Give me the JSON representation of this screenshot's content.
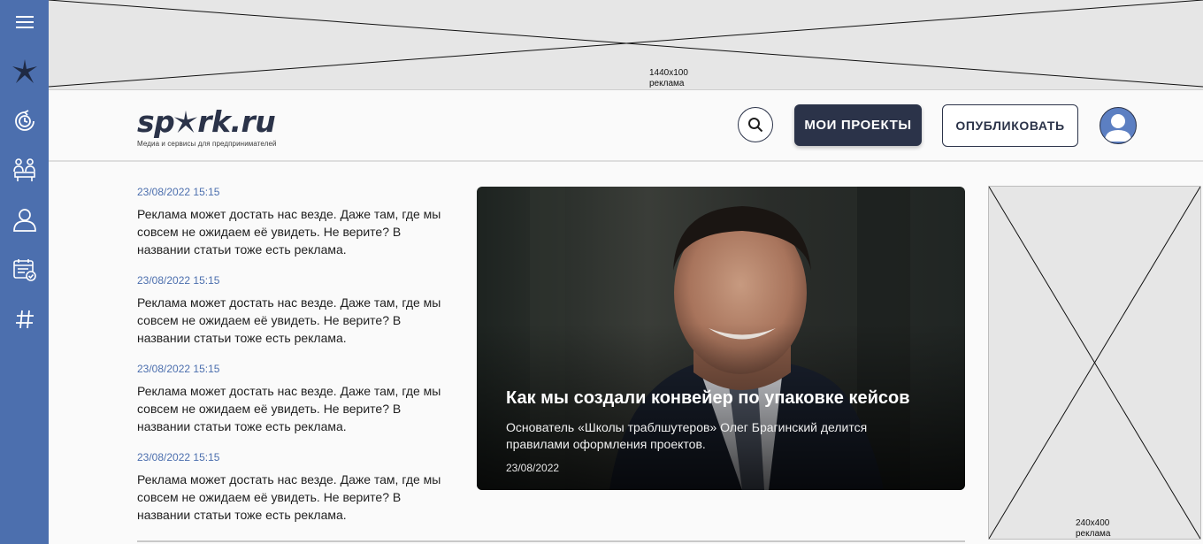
{
  "sidebar": {
    "icons": [
      "menu-icon",
      "star-icon",
      "clock-refresh-icon",
      "meeting-icon",
      "user-icon",
      "calendar-check-icon",
      "hashtag-icon"
    ],
    "color": "#4c6fae"
  },
  "ads": {
    "top": {
      "size": "1440x100",
      "label": "реклама"
    },
    "side": {
      "size": "240x400",
      "label": "реклама"
    }
  },
  "header": {
    "logo_prefix": "sp",
    "logo_suffix": "rk.ru",
    "logo_tagline": "Медиа и сервисы для предпринимателей",
    "my_projects_label": "МОИ ПРОЕКТЫ",
    "publish_label": "ОПУБЛИКОВАТЬ",
    "brand_color": "#2b3349"
  },
  "news": [
    {
      "date": "23/08/2022 15:15",
      "text": "Реклама может достать нас везде. Даже там, где мы совсем не ожидаем её увидеть. Не верите? В названии статьи тоже есть реклама."
    },
    {
      "date": "23/08/2022 15:15",
      "text": "Реклама может достать нас везде. Даже там, где мы совсем не ожидаем её увидеть. Не верите? В названии статьи тоже есть реклама."
    },
    {
      "date": "23/08/2022 15:15",
      "text": "Реклама может достать нас везде. Даже там, где мы совсем не ожидаем её увидеть. Не верите? В названии статьи тоже есть реклама."
    },
    {
      "date": "23/08/2022 15:15",
      "text": "Реклама может достать нас везде. Даже там, где мы совсем не ожидаем её увидеть. Не верите? В названии статьи тоже есть реклама."
    }
  ],
  "featured": {
    "title": "Как мы создали конвейер по упаковке кейсов",
    "description": "Основатель «Школы траблшутеров» Олег Брагинский делится правилами оформления проектов.",
    "date": "23/08/2022"
  }
}
